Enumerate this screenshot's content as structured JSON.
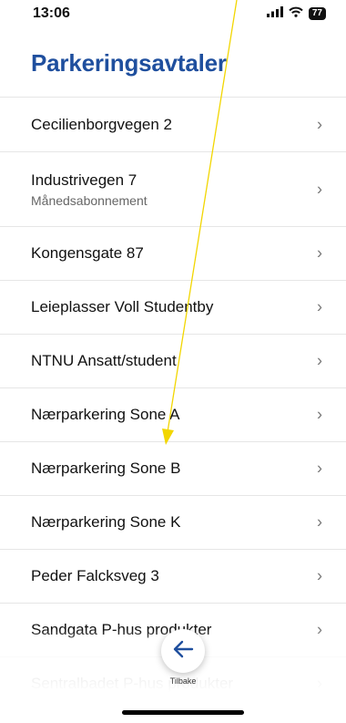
{
  "status_bar": {
    "time": "13:06",
    "battery": "77"
  },
  "header": {
    "title": "Parkeringsavtaler"
  },
  "list": {
    "items": [
      {
        "label": "Cecilienborgvegen 2",
        "sublabel": ""
      },
      {
        "label": "Industrivegen 7",
        "sublabel": "Månedsabonnement"
      },
      {
        "label": "Kongensgate 87",
        "sublabel": ""
      },
      {
        "label": "Leieplasser Voll Studentby",
        "sublabel": ""
      },
      {
        "label": "NTNU Ansatt/student",
        "sublabel": ""
      },
      {
        "label": "Nærparkering Sone A",
        "sublabel": ""
      },
      {
        "label": "Nærparkering Sone B",
        "sublabel": ""
      },
      {
        "label": "Nærparkering Sone K",
        "sublabel": ""
      },
      {
        "label": "Peder Falcksveg 3",
        "sublabel": ""
      },
      {
        "label": "Sandgata P-hus produkter",
        "sublabel": ""
      },
      {
        "label": "Sentralbadet P-hus produkter",
        "sublabel": ""
      }
    ]
  },
  "footer": {
    "back_label": "Tilbake"
  },
  "colors": {
    "title": "#1f4f9e",
    "back_arrow": "#1f4f9e",
    "annotation_arrow": "#f2d600"
  },
  "icons": {
    "signal": "signal-icon",
    "wifi": "wifi-icon",
    "battery": "battery-icon",
    "chevron": "chevron-right-icon",
    "back": "arrow-left-icon"
  }
}
